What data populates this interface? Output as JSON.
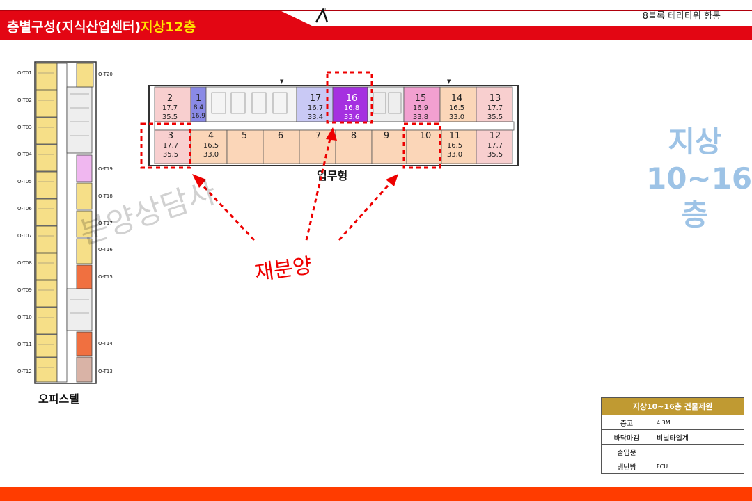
{
  "header": {
    "title_main": "층별구성(지식산업센터)",
    "title_floor": "지상12층",
    "project": "8블록 테라타워 향동",
    "colors": {
      "red": "#e30613",
      "yellow": "#ffe600",
      "footer": "#ff3c00"
    }
  },
  "office_plan": {
    "label": "오피스텔",
    "left_units": [
      "O-T01",
      "O-T02",
      "O-T03",
      "O-T04",
      "O-T05",
      "O-T06",
      "O-T07",
      "O-T08",
      "O-T09",
      "O-T10",
      "O-T11",
      "O-T12"
    ],
    "right_units": [
      "O-T20",
      "O-T19",
      "O-T18",
      "O-T17",
      "O-T16",
      "O-T15",
      "O-T14",
      "O-T13"
    ]
  },
  "business_plan": {
    "label": "업무형",
    "top_units": [
      {
        "num": "2",
        "area": "17.7",
        "total": "35.5",
        "color": "#f8cfcf"
      },
      {
        "num": "1",
        "area": "8.4",
        "total": "16.9",
        "color": "#8a8ae6"
      },
      {
        "num": "17",
        "area": "16.7",
        "total": "33.4",
        "color": "#c9c9f5"
      },
      {
        "num": "16",
        "area": "16.8",
        "total": "33.6",
        "color": "#a530e0"
      },
      {
        "num": "15",
        "area": "16.9",
        "total": "33.8",
        "color": "#f2a0d0"
      },
      {
        "num": "14",
        "area": "16.5",
        "total": "33.0",
        "color": "#fbd6b8"
      },
      {
        "num": "13",
        "area": "17.7",
        "total": "35.5",
        "color": "#f8cfcf"
      }
    ],
    "bottom_units": [
      {
        "num": "3",
        "area": "17.7",
        "total": "35.5",
        "color": "#f8cfcf"
      },
      {
        "num": "4",
        "area": "16.5",
        "total": "33.0",
        "color": "#fbd6b8"
      },
      {
        "num": "5",
        "area": "",
        "total": "",
        "color": "#fbd6b8"
      },
      {
        "num": "6",
        "area": "",
        "total": "",
        "color": "#fbd6b8"
      },
      {
        "num": "7",
        "area": "",
        "total": "",
        "color": "#fbd6b8"
      },
      {
        "num": "8",
        "area": "",
        "total": "",
        "color": "#fbd6b8"
      },
      {
        "num": "9",
        "area": "",
        "total": "",
        "color": "#fbd6b8"
      },
      {
        "num": "10",
        "area": "",
        "total": "",
        "color": "#fbd6b8"
      },
      {
        "num": "11",
        "area": "16.5",
        "total": "33.0",
        "color": "#fbd6b8"
      },
      {
        "num": "12",
        "area": "17.7",
        "total": "35.5",
        "color": "#f8cfcf"
      }
    ]
  },
  "annotation": {
    "redistribution": "재분양",
    "watermark": "분양상담사"
  },
  "side_label": {
    "line1": "지상",
    "line2": "10~16",
    "line3": "층",
    "color": "#9dc3e6"
  },
  "spec_table": {
    "title": "지상10~16층 건물제원",
    "rows": [
      {
        "key": "층고",
        "value": "4.3M"
      },
      {
        "key": "바닥마감",
        "value": "비닐타일계"
      },
      {
        "key": "출입문",
        "value": ""
      },
      {
        "key": "냉난방",
        "value": "FCU"
      }
    ]
  },
  "icons": {
    "north": "north-arrow-icon"
  }
}
